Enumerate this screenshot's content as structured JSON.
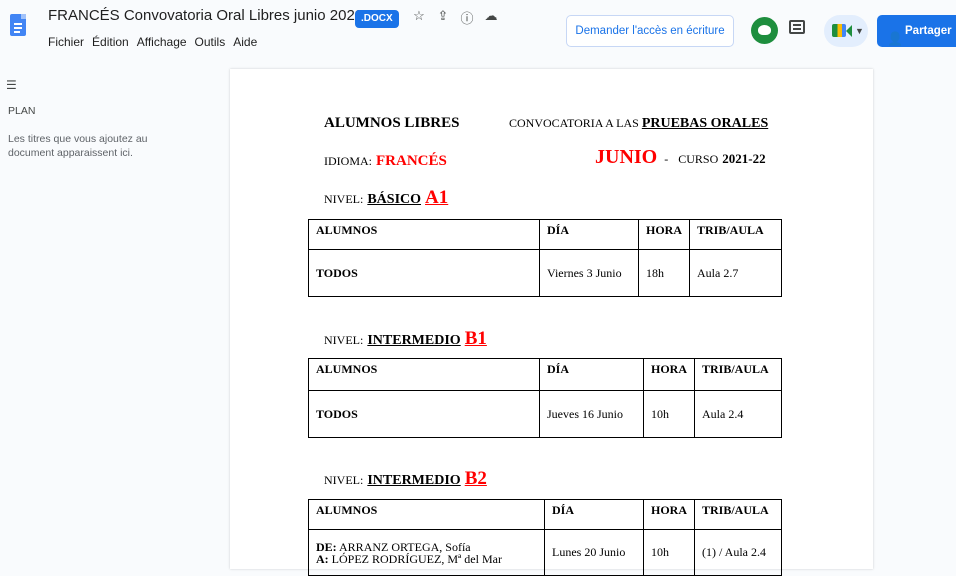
{
  "header": {
    "title": "FRANCÉS Convovatoria Oral Libres junio 2022",
    "badge": ".DOCX",
    "menu": [
      "Fichier",
      "Édition",
      "Affichage",
      "Outils",
      "Aide"
    ],
    "access_button": "Demander l'accès en écriture",
    "share_button": "Partager"
  },
  "sidebar": {
    "plan_label": "PLAN",
    "hint": "Les titres que vous ajoutez au document apparaissent ici."
  },
  "document": {
    "heading_left": "ALUMNOS LIBRES",
    "heading_right_prefix": "CONVOCATORIA A LAS",
    "heading_right_bold": "PRUEBAS ORALES",
    "idioma_label": "IDIOMA:",
    "idioma_value": "FRANCÉS",
    "month": "JUNIO",
    "dash": "-",
    "curso_label": "CURSO",
    "curso_value": "2021-22",
    "levels": [
      {
        "label": "NIVEL:",
        "name": "BÁSICO",
        "code": "A1"
      },
      {
        "label": "NIVEL:",
        "name": "INTERMEDIO",
        "code": "B1"
      },
      {
        "label": "NIVEL:",
        "name": "INTERMEDIO",
        "code": "B2"
      }
    ],
    "table_headers": [
      "ALUMNOS",
      "DÍA",
      "HORA",
      "TRIB/AULA"
    ],
    "tables": [
      {
        "alumnos": "TODOS",
        "dia": "Viernes 3 Junio",
        "hora": "18h",
        "aula": "Aula 2.7"
      },
      {
        "alumnos": "TODOS",
        "dia": "Jueves 16 Junio",
        "hora": "10h",
        "aula": "Aula 2.4"
      },
      {
        "alumnos_de_label": "DE:",
        "alumnos_de": "ARRANZ ORTEGA, Sofía",
        "alumnos_a_label": "A:",
        "alumnos_a": "LÓPEZ RODRÍGUEZ, Mª del Mar",
        "dia": "Lunes 20 Junio",
        "hora": "10h",
        "aula": "(1) / Aula 2.4"
      }
    ]
  }
}
